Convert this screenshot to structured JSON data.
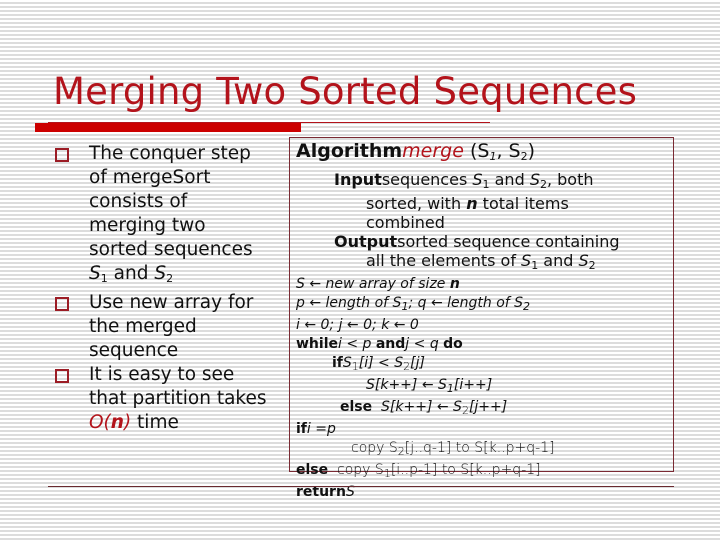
{
  "slide": {
    "title": "Merging Two Sorted Sequences",
    "colors": {
      "accent": "#cc0000",
      "title": "#b3131b",
      "text": "#111111",
      "box_border": "#7a2a33"
    },
    "bullets": [
      {
        "lines": [
          "The conquer step",
          "of mergeSort",
          "consists of",
          "merging two",
          "sorted sequences"
        ],
        "tail": {
          "s1": "S",
          "sub1": "1",
          "mid": " and ",
          "s2": "S",
          "sub2": "2"
        }
      },
      {
        "lines": [
          "Use new array for",
          "the merged",
          "sequence"
        ]
      },
      {
        "lines": [
          "It is easy to see",
          "that partition takes"
        ],
        "tail": {
          "o": "O(",
          "n": "n",
          "close": ")",
          "rest": " time"
        }
      }
    ],
    "algorithm": {
      "keyword": "Algorithm",
      "name": "merge",
      "params": "(S",
      "p_sub1": "1",
      "p_mid": ", S",
      "p_sub2": "2",
      "p_close": ")",
      "input_kw": "Input",
      "input_text_a": "sequences ",
      "input_s1": "S",
      "input_sub1": "1",
      "input_and": " and ",
      "input_s2": "S",
      "input_sub2": "2",
      "input_text_b": ", both",
      "input_line2_a": "sorted, with ",
      "input_line2_n": "n",
      "input_line2_b": " total items",
      "input_line3": "combined",
      "output_kw": "Output",
      "output_text": "sorted sequence containing",
      "output_line2_a": "all the elements of ",
      "output_s1": "S",
      "output_sub1": "1",
      "output_and": " and ",
      "output_s2": "S",
      "output_sub2": "2",
      "code": {
        "l1_a": "S ← new array of size ",
        "l1_n": "n",
        "l2_a": "p ← length of S",
        "l2_sub1": "1",
        "l2_b": "; q ← length of S",
        "l2_sub2": "2",
        "l3": "i ← 0; j ← 0; k ← 0",
        "l4_kw": "while",
        "l4_a": "i < p ",
        "l4_and": "and",
        "l4_b": "j < q ",
        "l4_do": "do",
        "l5_kw": "if",
        "l5_a": "S",
        "l5_sub1": "1",
        "l5_b": "[i] < S",
        "l5_sub2": "2",
        "l5_c": "[j]",
        "l6_a": "S[k++] ← S",
        "l6_sub": "1",
        "l6_b": "[i++]",
        "l7_kw": "else",
        "l7_a": "S[k++] ← S",
        "l7_sub": "2",
        "l7_b": "[j++]",
        "l8_kw": "if",
        "l8_a": "i =p",
        "l9_a": "copy S",
        "l9_sub": "2",
        "l9_b": "[j..q-1] to S[k..p+q-1]",
        "l10_kw": "else",
        "l10_a": "copy S",
        "l10_sub": "1",
        "l10_b": "[i..p-1] to S[k..p+q-1]",
        "l11_kw": "return",
        "l11_a": "S"
      }
    }
  }
}
